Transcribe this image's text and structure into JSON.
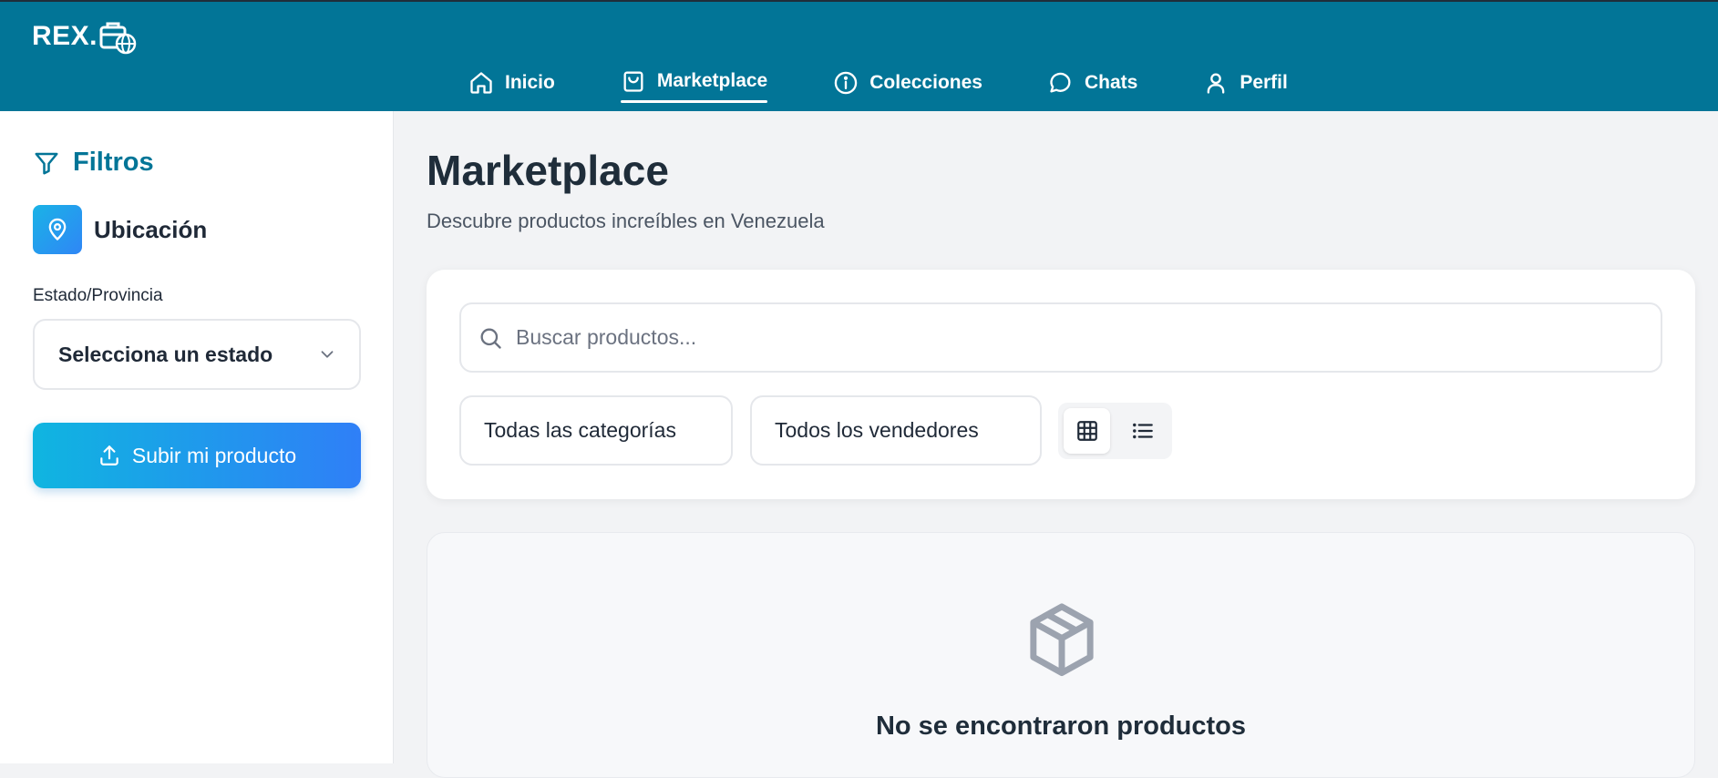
{
  "header": {
    "logo_text": "REX.",
    "nav": [
      {
        "label": "Inicio",
        "icon": "home-icon"
      },
      {
        "label": "Marketplace",
        "icon": "shopping-bag-icon",
        "active": true
      },
      {
        "label": "Colecciones",
        "icon": "info-circle-icon"
      },
      {
        "label": "Chats",
        "icon": "chat-bubble-icon"
      },
      {
        "label": "Perfil",
        "icon": "user-icon"
      }
    ]
  },
  "sidebar": {
    "title": "Filtros",
    "location_label": "Ubicación",
    "state_label": "Estado/Provincia",
    "state_value": "Selecciona un estado",
    "upload_label": "Subir mi producto"
  },
  "main": {
    "title": "Marketplace",
    "subtitle": "Descubre productos increíbles en Venezuela",
    "search_placeholder": "Buscar productos...",
    "category_value": "Todas las categorías",
    "seller_value": "Todos los vendedores",
    "view_mode": "grid",
    "empty_text": "No se encontraron productos"
  },
  "colors": {
    "header_bg": "#027597",
    "accent": "#027597",
    "button_gradient_start": "#0fb5e0",
    "button_gradient_end": "#2f7ff7"
  }
}
